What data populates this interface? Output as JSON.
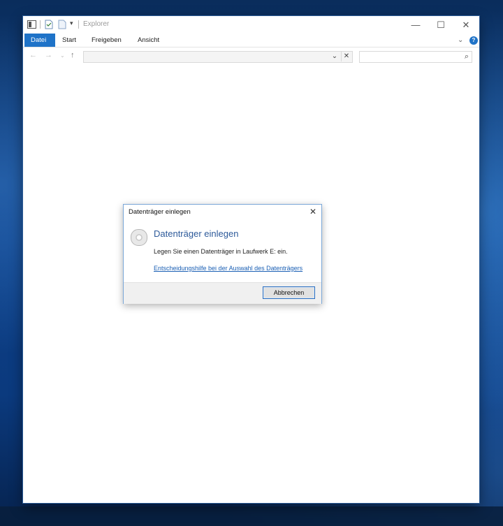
{
  "window": {
    "title": "Explorer",
    "controls": {
      "minimize": "—",
      "maximize": "☐",
      "close": "✕"
    }
  },
  "ribbon": {
    "tabs": [
      {
        "label": "Datei",
        "active": true
      },
      {
        "label": "Start",
        "active": false
      },
      {
        "label": "Freigeben",
        "active": false
      },
      {
        "label": "Ansicht",
        "active": false
      }
    ],
    "expand_glyph": "⌄",
    "help_glyph": "?"
  },
  "navigation": {
    "back_glyph": "←",
    "forward_glyph": "→",
    "recent_glyph": "⌄",
    "up_glyph": "↑",
    "address_value": "",
    "address_dropdown_glyph": "⌄",
    "address_clear_glyph": "✕",
    "search_value": "",
    "search_glyph": "⌕"
  },
  "dialog": {
    "title": "Datenträger einlegen",
    "close_glyph": "✕",
    "heading": "Datenträger einlegen",
    "message": "Legen Sie einen Datenträger in Laufwerk E: ein.",
    "help_link": "Entscheidungshilfe bei der Auswahl des Datenträgers",
    "cancel_button": "Abbrechen",
    "icon": "disc-icon"
  },
  "colors": {
    "accent": "#1f73c8",
    "dialog_heading": "#2d5a9a",
    "link": "#1a5fb4"
  }
}
